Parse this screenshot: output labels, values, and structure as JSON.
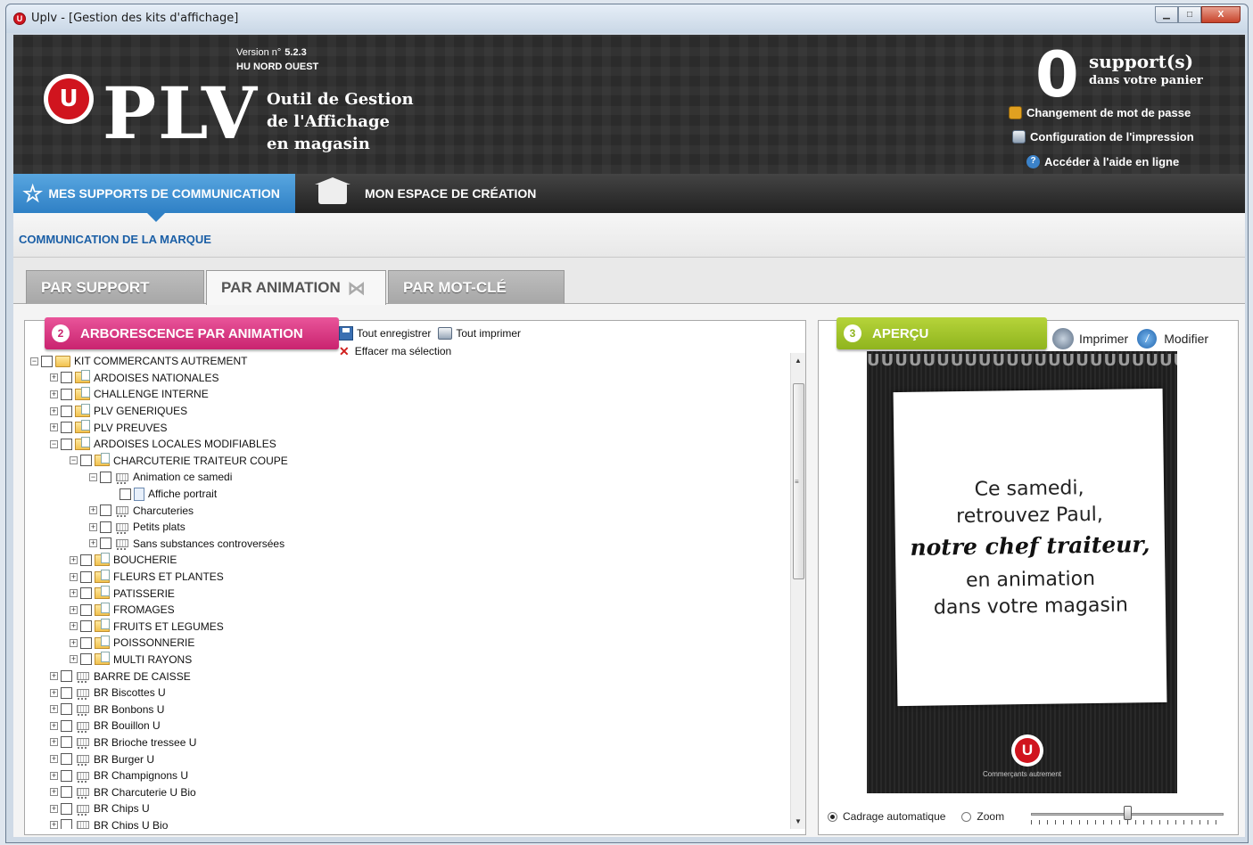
{
  "window": {
    "app_icon": "u-logo",
    "title": "Uplv - [Gestion des kits d'affichage]",
    "minimize": "▁",
    "maximize": "□",
    "close": "X"
  },
  "header": {
    "version_label": "Version n°",
    "version": "5.2.3",
    "region": "HU NORD OUEST",
    "logo_letter": "U",
    "logo_text": "PLV",
    "tagline_1": "Outil de Gestion",
    "tagline_2": "de l'Affichage",
    "tagline_3": "en magasin",
    "cart_count": "0",
    "cart_label": "support(s)",
    "cart_sub": "dans votre panier",
    "links": [
      {
        "label": "Changement de mot de passe",
        "icon": "lock-icon"
      },
      {
        "label": "Configuration de l'impression",
        "icon": "printer-icon"
      },
      {
        "label": "Accéder à l'aide en ligne",
        "icon": "help-icon"
      }
    ]
  },
  "nav": {
    "tabs": [
      {
        "label": "MES SUPPORTS DE COMMUNICATION",
        "icon": "star-icon",
        "active": true
      },
      {
        "label": "MON ESPACE DE CRÉATION",
        "icon": "creation-icon",
        "active": false
      }
    ],
    "section_title": "COMMUNICATION DE LA MARQUE"
  },
  "subtabs": [
    {
      "label": "PAR SUPPORT",
      "active": false
    },
    {
      "label": "PAR ANIMATION",
      "active": true,
      "icon": "butterfly-icon"
    },
    {
      "label": "PAR MOT-CLÉ",
      "active": false
    }
  ],
  "left_panel": {
    "step": "2",
    "title": "ARBORESCENCE PAR ANIMATION",
    "save_all": "Tout enregistrer",
    "print_all": "Tout imprimer",
    "clear_selection": "Effacer ma sélection",
    "tree": [
      {
        "label": "KIT COMMERCANTS AUTREMENT",
        "level": 0,
        "expander": "−",
        "icon": "folder"
      },
      {
        "label": "ARDOISES NATIONALES",
        "level": 1,
        "expander": "+",
        "icon": "folder-doc"
      },
      {
        "label": "CHALLENGE INTERNE",
        "level": 1,
        "expander": "+",
        "icon": "folder-doc"
      },
      {
        "label": "PLV GENERIQUES",
        "level": 1,
        "expander": "+",
        "icon": "folder-doc"
      },
      {
        "label": "PLV PREUVES",
        "level": 1,
        "expander": "+",
        "icon": "folder-doc"
      },
      {
        "label": "ARDOISES LOCALES MODIFIABLES",
        "level": 1,
        "expander": "−",
        "icon": "folder-doc"
      },
      {
        "label": "CHARCUTERIE TRAITEUR COUPE",
        "level": 2,
        "expander": "−",
        "icon": "folder-doc"
      },
      {
        "label": "Animation ce samedi",
        "level": 3,
        "expander": "−",
        "icon": "cart"
      },
      {
        "label": "Affiche portrait",
        "level": 4,
        "expander": "",
        "icon": "doc"
      },
      {
        "label": "Charcuteries",
        "level": 3,
        "expander": "+",
        "icon": "cart"
      },
      {
        "label": "Petits plats",
        "level": 3,
        "expander": "+",
        "icon": "cart"
      },
      {
        "label": "Sans substances controversées",
        "level": 3,
        "expander": "+",
        "icon": "cart"
      },
      {
        "label": "BOUCHERIE",
        "level": 2,
        "expander": "+",
        "icon": "folder-doc"
      },
      {
        "label": "FLEURS ET PLANTES",
        "level": 2,
        "expander": "+",
        "icon": "folder-doc"
      },
      {
        "label": "PATISSERIE",
        "level": 2,
        "expander": "+",
        "icon": "folder-doc"
      },
      {
        "label": "FROMAGES",
        "level": 2,
        "expander": "+",
        "icon": "folder-doc"
      },
      {
        "label": "FRUITS ET LEGUMES",
        "level": 2,
        "expander": "+",
        "icon": "folder-doc"
      },
      {
        "label": "POISSONNERIE",
        "level": 2,
        "expander": "+",
        "icon": "folder-doc"
      },
      {
        "label": "MULTI RAYONS",
        "level": 2,
        "expander": "+",
        "icon": "folder-doc"
      },
      {
        "label": "BARRE DE CAISSE",
        "level": 1,
        "expander": "+",
        "icon": "cart"
      },
      {
        "label": "BR Biscottes U",
        "level": 1,
        "expander": "+",
        "icon": "cart"
      },
      {
        "label": "BR Bonbons U",
        "level": 1,
        "expander": "+",
        "icon": "cart"
      },
      {
        "label": "BR Bouillon U",
        "level": 1,
        "expander": "+",
        "icon": "cart"
      },
      {
        "label": "BR Brioche tressee U",
        "level": 1,
        "expander": "+",
        "icon": "cart"
      },
      {
        "label": "BR Burger U",
        "level": 1,
        "expander": "+",
        "icon": "cart"
      },
      {
        "label": "BR Champignons U",
        "level": 1,
        "expander": "+",
        "icon": "cart"
      },
      {
        "label": "BR Charcuterie U Bio",
        "level": 1,
        "expander": "+",
        "icon": "cart"
      },
      {
        "label": "BR Chips U",
        "level": 1,
        "expander": "+",
        "icon": "cart"
      },
      {
        "label": "BR Chips U Bio",
        "level": 1,
        "expander": "+",
        "icon": "cart"
      }
    ],
    "scroll_up": "▲",
    "scroll_down": "▼",
    "scroll_grip": "≡"
  },
  "right_panel": {
    "step": "3",
    "title": "APERÇU",
    "print": "Imprimer",
    "edit": "Modifier",
    "edit_glyph": "/",
    "poster": {
      "band": "UUUUUUUUUUUUUUUUUUUUUUUUUUUUUU",
      "line1": "Ce samedi,",
      "line2": "retrouvez Paul,",
      "line3": "notre chef traiteur,",
      "line4": "en animation",
      "line5": "dans votre magasin",
      "logo_letter": "U",
      "slogan": "Commerçants autrement"
    },
    "fit_auto": "Cadrage automatique",
    "zoom": "Zoom",
    "zoom_level": 0.5
  }
}
